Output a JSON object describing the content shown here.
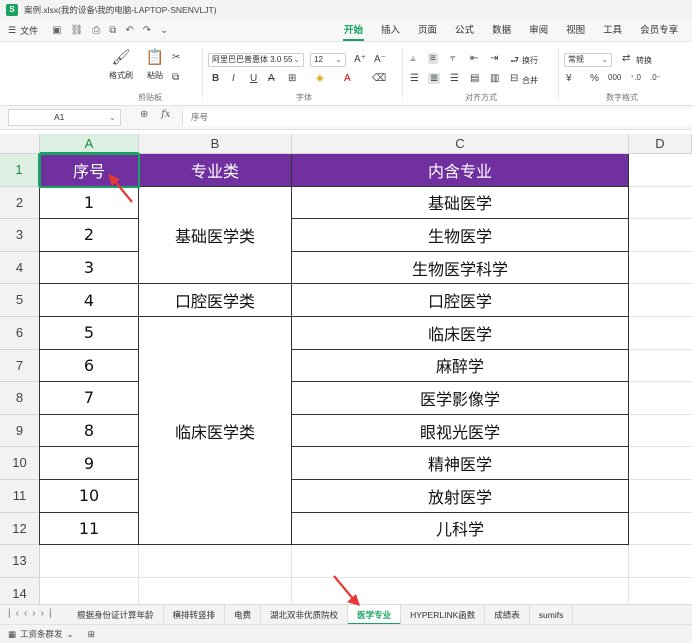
{
  "window": {
    "title": "案例.xlsx(我的设备\\我的电脑-LAPTOP-SNENVLJT)",
    "logo": "S"
  },
  "menu": {
    "file_label": "文件",
    "tabs": [
      "开始",
      "插入",
      "页面",
      "公式",
      "数据",
      "审阅",
      "视图",
      "工具",
      "会员专享"
    ],
    "active_tab": "开始"
  },
  "ribbon": {
    "clipboard": {
      "label": "剪贴板",
      "format_painter": "格式刷",
      "paste": "粘贴"
    },
    "font": {
      "label": "字体",
      "font_name": "阿里巴巴普惠体 3.0 55",
      "font_size": "12"
    },
    "alignment": {
      "label": "对齐方式",
      "wrap": "换行",
      "merge": "合并"
    },
    "number": {
      "label": "数字格式",
      "format": "常规",
      "convert": "转换"
    }
  },
  "formula_bar": {
    "cell_ref": "A1",
    "fx": "fx",
    "content": "序号"
  },
  "grid": {
    "columns": [
      "A",
      "B",
      "C",
      "D"
    ],
    "rows": [
      "1",
      "2",
      "3",
      "4",
      "5",
      "6",
      "7",
      "8",
      "9",
      "10",
      "11",
      "12",
      "13",
      "14"
    ],
    "headers": [
      "序号",
      "专业类",
      "内含专业"
    ],
    "seq": [
      "1",
      "2",
      "3",
      "4",
      "5",
      "6",
      "7",
      "8",
      "9",
      "10",
      "11"
    ],
    "groups": [
      "基础医学类",
      "口腔医学类",
      "临床医学类"
    ],
    "majors": [
      "基础医学",
      "生物医学",
      "生物医学科学",
      "口腔医学",
      "临床医学",
      "麻醉学",
      "医学影像学",
      "眼视光医学",
      "精神医学",
      "放射医学",
      "儿科学"
    ]
  },
  "sheets": {
    "tabs": [
      "根据身份证计算年龄",
      "横排转竖排",
      "电费",
      "湖北双非优质院校",
      "医学专业",
      "HYPERLINK函数",
      "成绩表",
      "sumifs"
    ],
    "active": "医学专业"
  },
  "status": {
    "label": "工资条群发"
  },
  "colors": {
    "accent": "#1aa260",
    "header_fill": "#7030a0",
    "arrow": "#e53935"
  }
}
